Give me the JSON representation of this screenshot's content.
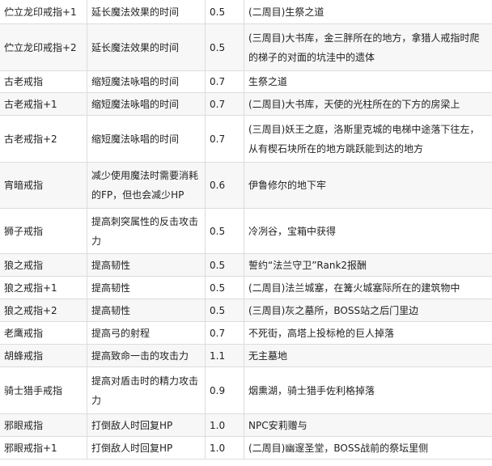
{
  "table": {
    "rows": [
      {
        "name": "伫立龙印戒指+1",
        "effect": "延长魔法效果的时间",
        "weight": "0.5",
        "location": "(二周目)生祭之道"
      },
      {
        "name": "伫立龙印戒指+2",
        "effect": "延长魔法效果的时间",
        "weight": "0.5",
        "location": "(三周目)大书库，金三胖所在的地方，拿猎人戒指时爬的梯子的对面的坑洼中的遗体"
      },
      {
        "name": "古老戒指",
        "effect": "缩短魔法咏唱的时间",
        "weight": "0.7",
        "location": "生祭之道"
      },
      {
        "name": "古老戒指+1",
        "effect": "缩短魔法咏唱的时间",
        "weight": "0.7",
        "location": "(二周目)大书库，天使的光柱所在的下方的房梁上"
      },
      {
        "name": "古老戒指+2",
        "effect": "缩短魔法咏唱的时间",
        "weight": "0.7",
        "location": "(三周目)妖王之庭，洛斯里克城的电梯中途落下往左，从有楔石块所在的地方跳跃能到达的地方"
      },
      {
        "name": "宵暗戒指",
        "effect": "减少使用魔法时需要消耗的FP，但也会减少HP",
        "weight": "0.6",
        "location": "伊鲁修尔的地下牢"
      },
      {
        "name": "狮子戒指",
        "effect": "提高刺突属性的反击攻击力",
        "weight": "0.5",
        "location": "冷冽谷，宝箱中获得"
      },
      {
        "name": "狼之戒指",
        "effect": "提高韧性",
        "weight": "0.5",
        "location": "誓约“法兰守卫”Rank2报酬"
      },
      {
        "name": "狼之戒指+1",
        "effect": "提高韧性",
        "weight": "0.5",
        "location": "(二周目)法兰城塞，在篝火城塞际所在的建筑物中"
      },
      {
        "name": "狼之戒指+2",
        "effect": "提高韧性",
        "weight": "0.5",
        "location": "(三周目)灰之墓所，BOSS站之后门里边"
      },
      {
        "name": "老鹰戒指",
        "effect": "提高弓的射程",
        "weight": "0.7",
        "location": "不死街，高塔上投标枪的巨人掉落"
      },
      {
        "name": "胡蜂戒指",
        "effect": "提高致命一击的攻击力",
        "weight": "1.1",
        "location": "无主墓地"
      },
      {
        "name": "骑士猎手戒指",
        "effect": "提高对盾击时的精力攻击力",
        "weight": "0.9",
        "location": "烟熏湖，骑士猎手佐利格掉落"
      },
      {
        "name": "邪眼戒指",
        "effect": "打倒敌人时回复HP",
        "weight": "1.0",
        "location": "NPC安莉赠与"
      },
      {
        "name": "邪眼戒指+1",
        "effect": "打倒敌人时回复HP",
        "weight": "1.0",
        "location": "(二周目)幽邃圣堂，BOSS战前的祭坛里侧"
      }
    ]
  }
}
